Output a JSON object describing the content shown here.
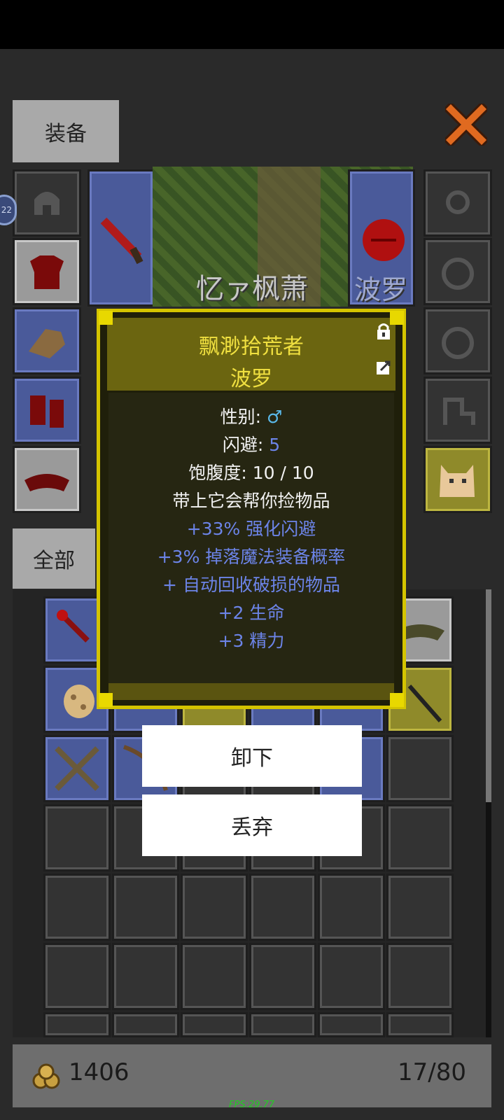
{
  "top_tab": "装备",
  "filter_tab": "全部",
  "hero_name": "忆ァ枫萧",
  "pet_name_bg": "波罗",
  "side_badge": "22",
  "tooltip": {
    "title": "飘渺拾荒者",
    "name": "波罗",
    "lines": [
      {
        "label": "性别:",
        "value": "♂"
      },
      {
        "label": "闪避:",
        "value": "5"
      },
      {
        "label": "饱腹度: 10 / 10",
        "value": ""
      }
    ],
    "desc": "带上它会帮你捡物品",
    "bonuses": [
      "+33% 强化闪避",
      "+3% 掉落魔法装备概率",
      "+ 自动回收破损的物品",
      "+2 生命",
      "+3 精力"
    ]
  },
  "buttons": {
    "unequip": "卸下",
    "discard": "丢弃"
  },
  "gold": "1406",
  "capacity": "17/80",
  "fps": "FPS:29.77",
  "colors": {
    "tooltip_border": "#d4c400",
    "title": "#f0e040",
    "bonus": "#6c84e8",
    "fps": "#22cc22"
  }
}
